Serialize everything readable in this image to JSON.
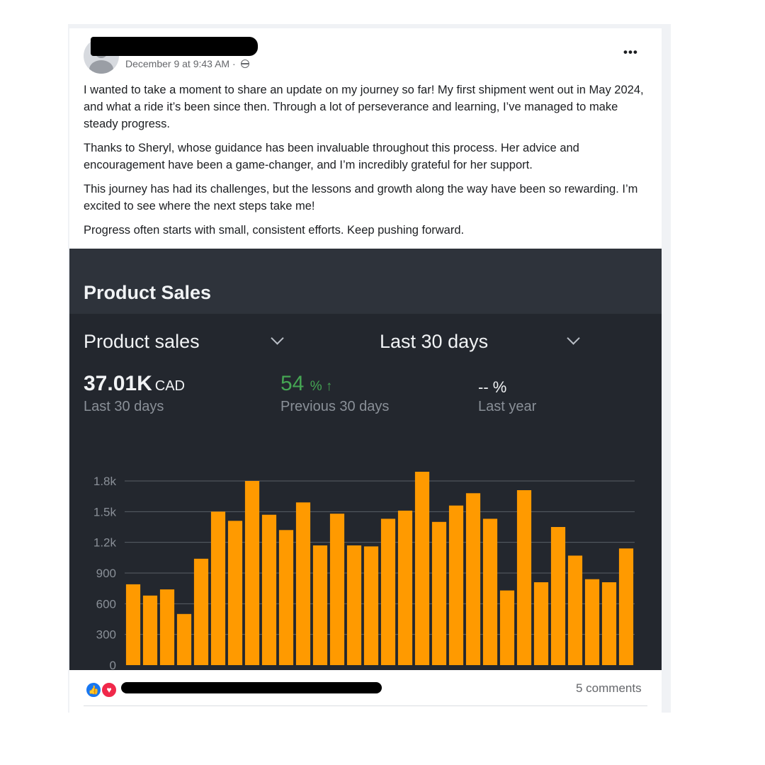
{
  "post": {
    "date": "December 9 at 9:43 AM ·",
    "paragraphs": [
      "I wanted to take a moment to share an update on my journey so far! My first shipment went out in May 2024, and what a ride it’s been since then. Through a lot of perseverance and learning, I’ve managed to make steady progress.",
      "Thanks to Sheryl, whose guidance has been invaluable throughout this process. Her advice and encouragement have been a game-changer, and I’m incredibly grateful for her support.",
      "This journey has had its challenges, but the lessons and growth along the way have been so rewarding. I’m excited to see where the next steps take me!",
      "Progress often starts with small, consistent efforts. Keep pushing forward."
    ],
    "more_icon": "•••"
  },
  "screenshot": {
    "title": "Product Sales",
    "metric_dropdown": "Product sales",
    "period_dropdown": "Last 30 days",
    "metrics": [
      {
        "value": "37.01K",
        "unit": "CAD",
        "label": "Last 30 days"
      },
      {
        "value": "54",
        "unit": "% ↑",
        "label": "Previous 30 days",
        "color": "#45a553"
      },
      {
        "value": "--",
        "unit": "%",
        "label": "Last year"
      }
    ]
  },
  "footer": {
    "comments": "5 comments",
    "like_icon": "👍",
    "love_icon": "♥"
  },
  "colors": {
    "bar": "#ff9a00",
    "panel_bg": "#23272e",
    "header_bg": "#2e333b",
    "green": "#45a553"
  },
  "chart_data": {
    "type": "bar",
    "title": "",
    "xlabel": "",
    "ylabel": "",
    "ylim": [
      0,
      1800
    ],
    "yticks": [
      0,
      300,
      600,
      900,
      "1.2k",
      "1.5k",
      "1.8k"
    ],
    "grid": true,
    "values": [
      790,
      680,
      740,
      500,
      1040,
      1500,
      1410,
      1800,
      1470,
      1320,
      1590,
      1170,
      1480,
      1170,
      1160,
      1430,
      1510,
      1890,
      1400,
      1560,
      1680,
      1430,
      730,
      1710,
      810,
      1350,
      1070,
      840,
      810,
      1140
    ]
  }
}
